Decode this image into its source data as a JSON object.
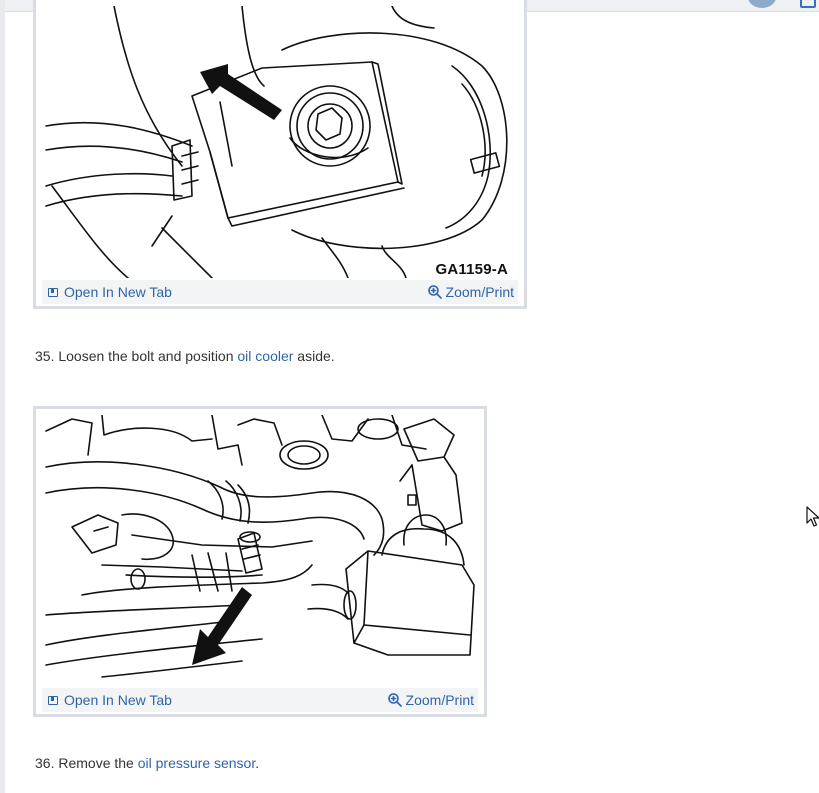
{
  "figures": [
    {
      "label": "GA1159-A",
      "open_link": "Open In New Tab",
      "zoom_link": "Zoom/Print"
    },
    {
      "label": "",
      "open_link": "Open In New Tab",
      "zoom_link": "Zoom/Print"
    }
  ],
  "steps": [
    {
      "number": "35.",
      "before": "Loosen the bolt and position ",
      "link": "oil cooler",
      "after": " aside."
    },
    {
      "number": "36.",
      "before": "Remove the ",
      "link": "oil pressure sensor",
      "after": "."
    }
  ],
  "colors": {
    "link": "#2f64a8",
    "text": "#333333",
    "figure_border": "#d9dde3",
    "footer_bg": "#f3f4f6"
  },
  "icons": [
    "open-new-tab-icon",
    "zoom-in-icon",
    "mouse-pointer-icon"
  ]
}
